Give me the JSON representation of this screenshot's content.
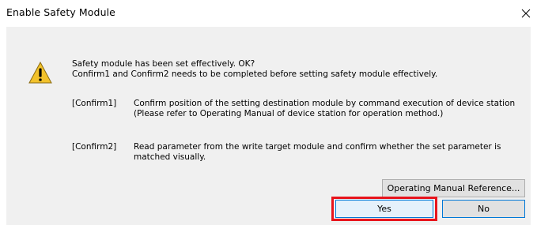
{
  "window": {
    "title": "Enable Safety Module",
    "close_glyph": "close-icon"
  },
  "message": {
    "line1": "Safety module has been set effectively. OK?",
    "line2": "Confirm1 and Confirm2 needs to be completed before setting safety module effectively.",
    "icon": "warning-icon"
  },
  "confirm1": {
    "tag": "[Confirm1]",
    "line1": "Confirm position of the setting destination module by command execution of device station",
    "line2": "(Please refer to Operating Manual of device station for operation method.)"
  },
  "confirm2": {
    "tag": "[Confirm2]",
    "line1": "Read parameter from the write target module and confirm whether the set parameter is",
    "line2": "matched visually."
  },
  "buttons": {
    "manual_reference": "Operating Manual Reference...",
    "yes": "Yes",
    "no": "No"
  },
  "colors": {
    "highlight": "#e8141c",
    "focus_border": "#0078d7",
    "warning_fill": "#f2c22b"
  }
}
